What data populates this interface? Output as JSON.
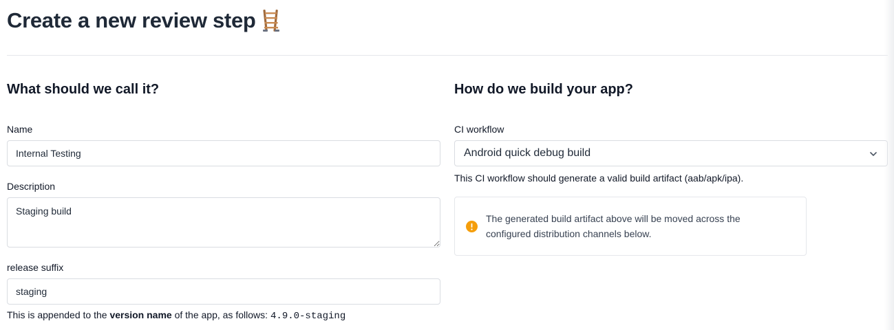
{
  "header": {
    "title": "Create a new review step",
    "icon": "ladder-icon"
  },
  "left_section": {
    "heading": "What should we call it?",
    "name_field": {
      "label": "Name",
      "value": "Internal Testing"
    },
    "description_field": {
      "label": "Description",
      "value": "Staging build"
    },
    "suffix_field": {
      "label": "release suffix",
      "value": "staging"
    },
    "suffix_hint": {
      "prefix": "This is appended to the ",
      "emphasis": "version name",
      "middle": " of the app, as follows:",
      "example": "4.9.0-staging"
    }
  },
  "right_section": {
    "heading": "How do we build your app?",
    "workflow_field": {
      "label": "CI workflow",
      "selected": "Android quick debug build",
      "icon": "chevron-down-icon"
    },
    "workflow_hint": "This CI workflow should generate a valid build artifact (aab/apk/ipa).",
    "callout": {
      "icon": "warning-icon",
      "text": "The generated build artifact above will be moved across the configured distribution channels below."
    }
  },
  "colors": {
    "heading": "#1f2937",
    "border": "#d9dce1",
    "warning": "#f59e0b"
  }
}
